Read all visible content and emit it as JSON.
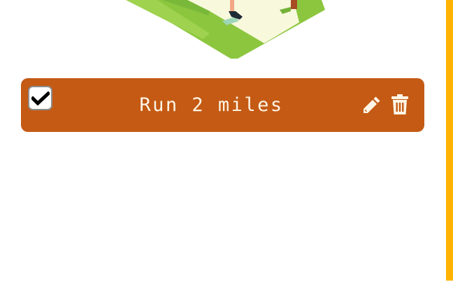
{
  "todo": {
    "text": "Run 2 miles",
    "completed": true,
    "actions": {
      "edit_icon": "pencil-icon",
      "delete_icon": "trash-icon"
    }
  },
  "colors": {
    "card_background": "#c45a14",
    "card_text": "#fdf5e6",
    "accent_bar": "#ffb300",
    "grass_green": "#8cc63f",
    "path_cream": "#f8f8dc"
  }
}
